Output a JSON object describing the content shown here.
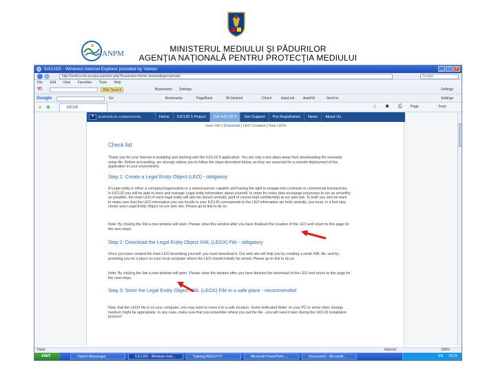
{
  "header": {
    "line1": "MINISTERUL MEDIULUI ŞI PĂDURILOR",
    "line2": "AGENŢIA NAŢIONALĂ PENTRU PROTECŢIA MEDIULUI",
    "anpm_logo_text": "ANPM"
  },
  "browser": {
    "title": "IUCLID5 - Windows Internet Explorer provided by Yahoo!",
    "address": "http://iuclid.echa.europa.eu/index.php?fuseaction=home.license&type=private",
    "search_placeholder": "Google",
    "menu": [
      "File",
      "Edit",
      "View",
      "Favorites",
      "Tools",
      "Help"
    ],
    "yahoo_toolbar": {
      "logo": "Y!",
      "search_button": "Web Search",
      "items": [
        "Bookmarks",
        "Settings"
      ],
      "right_item": "Settings"
    },
    "google_toolbar": {
      "logo": "Google",
      "go_label": "Go",
      "items": [
        "Bookmarks",
        "PageRank",
        "86 blocked",
        "Check",
        "AutoLink",
        "AutoFill",
        "Send to"
      ],
      "right_item": "Settings"
    },
    "tab_label": "IUCLID",
    "command_items": [
      "Page",
      "Tools"
    ],
    "status_text": "Done",
    "status_zone": "Internet",
    "zoom": "100%"
  },
  "site": {
    "eu_label": "EUROPEAN COMMISSION",
    "nav": [
      "Home",
      "IUCLID 5 Project",
      "Get IUCLID 5",
      "Get Support",
      "Pre-Registration",
      "News",
      "About Us"
    ],
    "subnav_user": "User Info",
    "subnav_sep1": " | ",
    "subnav_download": "Download",
    "subnav_sep2": " | ",
    "subnav_leo": "LEO Creation",
    "subnav_sep3": " | ",
    "subnav_your": "Your LEOs",
    "title": "Check list",
    "intro": "Thank you for your interest in installing and working with the IUCLID 5 application. You are only a few steps away from downloading the essential setup file. Before proceeding, we strongly advise you to follow the steps described below, as they are essential for a smooth deployment of the application in your environment.",
    "step1_title": "Step 1: Create a Legal Entity Object (LEO) - obligatory",
    "step1_text": "A Legal entity is either a company/organisation or a natural person capable and having the right to engage into contracts or commercial transactions. In IUCLID you will be able to store and manage Legal entity information about yourself. In order for many data exchange processes to run as smoothly as possible, the main LEO of each legal entity will also be stored centrally (and of course kept confidential) at our web site. To both you and we want to make sure that the LEO information you use locally in your IUCLID corresponds to the LEO information we hold centrally, you must, in a first step create your Legal Entity Object on our web site. Please go to link to do so.",
    "step1_note": "Note: By clicking the link a new window will open. Please close this window after you have finalised the creation of the LEO and return to this page for the next steps.",
    "step2_title": "Step 2: Download the Legal Entity Object XML (LEOX) File - obligatory",
    "step2_text": "Once you have created the main LEO describing yourself, you must download it. Our web site will help you by creating a small XML file, and by providing you for a place on your local computer where the LEO should initially be stored. Please go to link to do so.",
    "step2_note": "Note: By clicking the link a new window will open. Please close the window after you have finished the download of the LEO and return to this page for the next steps.",
    "step3_title": "Step 3: Store the Legal Entity Object XML (LEOX) File in a safe place - recommended",
    "step3_text": "Now, that the LEOX file is on your computer, you may want to move it to a safe location. Some dedicated folder on your PC or some other storage medium might be appropriate. In any case, make sure that you remember where you put the file - you will need it later during the IUCLID installation process!"
  },
  "taskbar": {
    "start": "start",
    "tasks": [
      "Yahoo! Messenger",
      "IUCLID5 - Windows Inter...",
      "Training REACH-IT",
      "Microsoft PowerPoint -...",
      "Document1 - Microsoft..."
    ],
    "tray_lang": "EN",
    "clock": "15:22"
  },
  "colors": {
    "eu_blue": "#1d4f91",
    "link_blue": "#3067b7",
    "arrow_red": "#d91c1c"
  }
}
